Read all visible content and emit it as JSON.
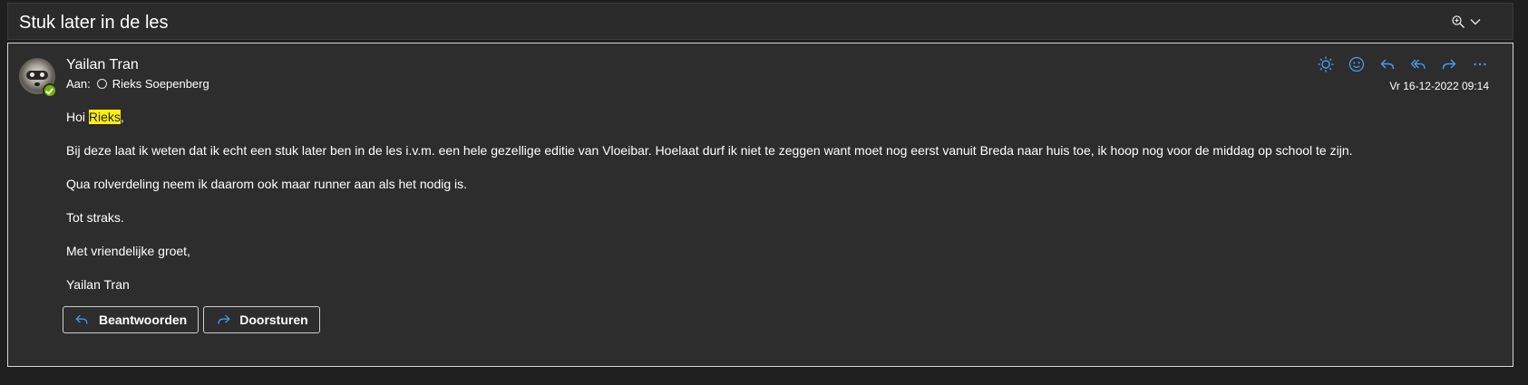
{
  "subject": "Stuk later in de les",
  "colors": {
    "accent": "#479ef5",
    "highlight": "#fff100",
    "presence": "#6bb700"
  },
  "header_icons": [
    "zoom-icon",
    "chevron-down-icon"
  ],
  "message": {
    "sender": "Yailan Tran",
    "to_label": "Aan:",
    "recipient": "Rieks Soepenberg",
    "date": "Vr 16-12-2022 09:14",
    "actions": [
      "sun-icon",
      "emoji-icon",
      "reply-icon",
      "reply-all-icon",
      "forward-icon",
      "more-icon"
    ],
    "greeting_prefix": "Hoi ",
    "greeting_name": "Rieks",
    "greeting_suffix": ",",
    "paragraphs": [
      "Bij deze laat ik weten dat ik echt een stuk later ben in de les i.v.m. een hele gezellige editie van Vloeibar. Hoelaat durf ik niet te zeggen want moet nog eerst vanuit Breda naar huis toe, ik hoop nog voor de middag op school te zijn.",
      "Qua rolverdeling neem ik daarom ook maar runner aan als het nodig is.",
      "Tot straks.",
      "Met vriendelijke groet,",
      "Yailan Tran"
    ]
  },
  "buttons": {
    "reply": "Beantwoorden",
    "forward": "Doorsturen"
  }
}
